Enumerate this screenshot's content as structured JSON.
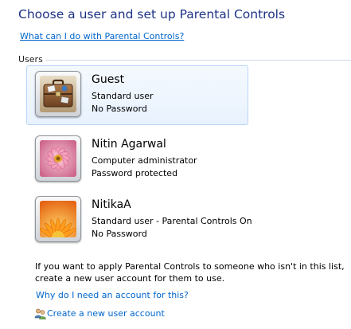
{
  "page": {
    "title": "Choose a user and set up Parental Controls",
    "help_link": "What can I do with Parental Controls?"
  },
  "users_section": {
    "label": "Users",
    "users": [
      {
        "name": "Guest",
        "type": "Standard user",
        "password": "No Password",
        "picture": "briefcase-picture",
        "selected": true
      },
      {
        "name": "Nitin Agarwal",
        "type": "Computer administrator",
        "password": "Password protected",
        "picture": "pink-flower-picture",
        "selected": false
      },
      {
        "name": "NitikaA",
        "type": "Standard user - Parental Controls On",
        "password": "No Password",
        "picture": "orange-flower-picture",
        "selected": false
      }
    ]
  },
  "footer": {
    "info_text": "If you want to apply Parental Controls to someone who isn't in this list, create a new user account for them to use.",
    "why_link": "Why do I need an account for this?",
    "create_link": "Create a new user account",
    "create_icon": "users-add-icon"
  },
  "colors": {
    "title": "#1e3287",
    "link": "#0066cc",
    "selection_border": "#b8d6fb",
    "selection_fill": "#e8f2fe"
  }
}
